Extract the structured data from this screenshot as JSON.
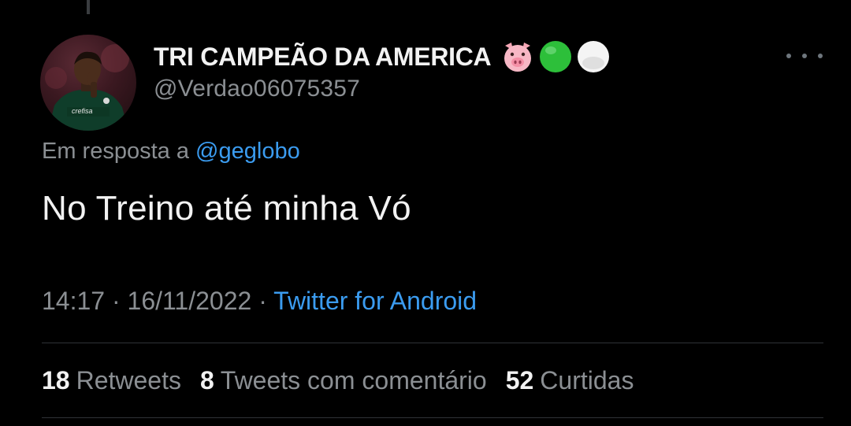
{
  "tweet": {
    "author": {
      "display_name": "TRI CAMPEÃO DA AMERICA",
      "emoji_icons": [
        "pig-face-icon",
        "green-circle-icon",
        "white-circle-icon"
      ],
      "handle": "@Verdao06075357",
      "avatar_shirt_text": "crefisa"
    },
    "reply": {
      "prefix": "Em resposta a",
      "mention": "@geglobo"
    },
    "text": "No Treino até minha Vó",
    "meta": {
      "time": "14:17",
      "separator": " · ",
      "date": "16/11/2022",
      "source": "Twitter for Android"
    },
    "stats": {
      "retweets_count": "18",
      "retweets_label": "Retweets",
      "quotes_count": "8",
      "quotes_label": "Tweets com comentário",
      "likes_count": "52",
      "likes_label": "Curtidas"
    }
  },
  "colors": {
    "background": "#000000",
    "primary_text": "#f2f2f2",
    "secondary_text": "#8b8f93",
    "link": "#3b9cf0",
    "divider": "#2f3336"
  }
}
